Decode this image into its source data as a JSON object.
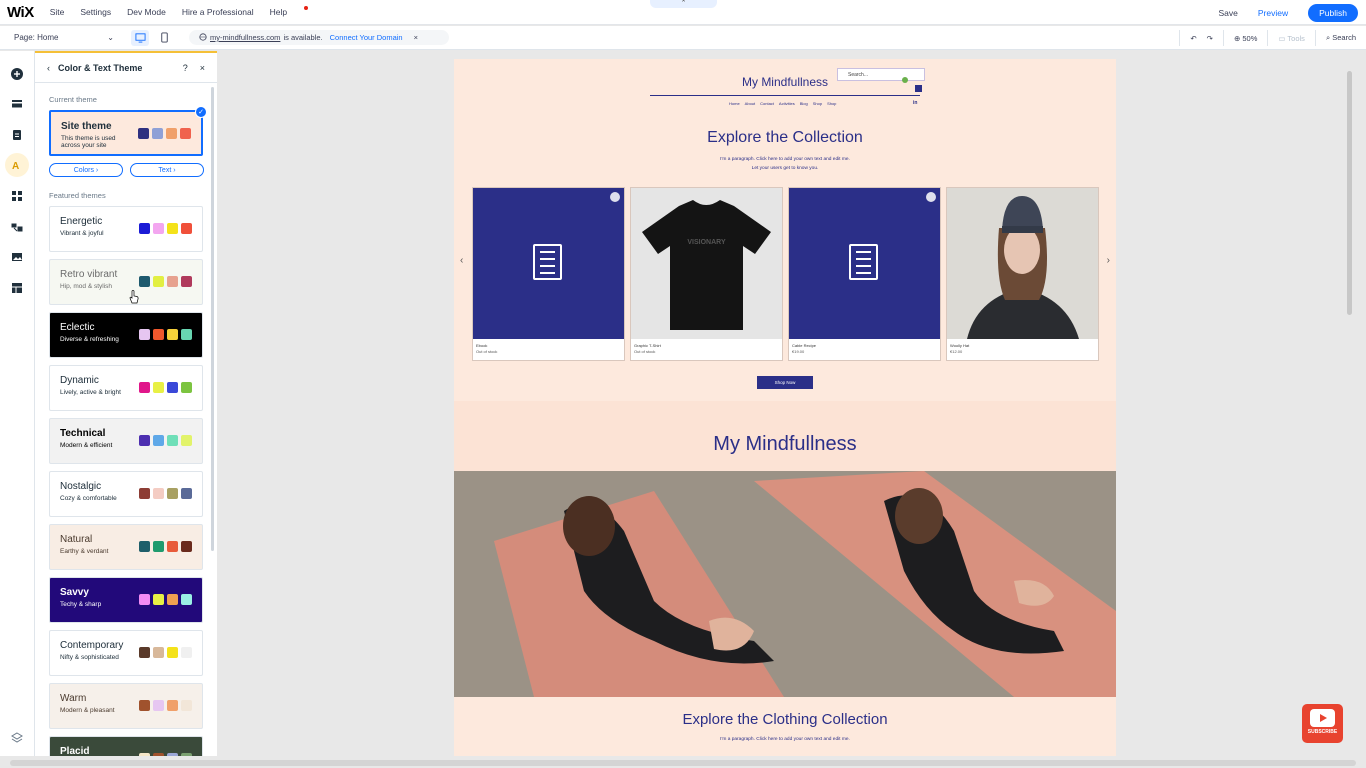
{
  "topbar": {
    "logo": "WiX",
    "menu": [
      "Site",
      "Settings",
      "Dev Mode",
      "Hire a Professional",
      "Help"
    ],
    "save": "Save",
    "preview": "Preview",
    "publish": "Publish"
  },
  "secondbar": {
    "page_label": "Page: Home",
    "page_chevron": "⌄",
    "domain": "my-mindfullness.com",
    "available": "is available.",
    "connect": "Connect Your Domain",
    "close": "×",
    "zoom": "50%",
    "tools": "Tools",
    "search": "Search"
  },
  "panel": {
    "back": "‹",
    "title": "Color & Text Theme",
    "help": "?",
    "close": "×",
    "current_label": "Current theme",
    "current": {
      "name": "Site theme",
      "desc": "This theme is used across your site",
      "swatches": [
        "#2f3180",
        "#8fa0d6",
        "#f0a06a",
        "#f0624d"
      ],
      "bg": "#fde9dd"
    },
    "colors_btn": "Colors",
    "text_btn": "Text",
    "chev": "›",
    "featured_label": "Featured themes",
    "themes": [
      {
        "name": "Energetic",
        "desc": "Vibrant & joyful",
        "bg": "#ffffff",
        "fg": "#20303c",
        "bold": false,
        "swatches": [
          "#1b1bd6",
          "#f3a6f0",
          "#f4e21a",
          "#f0503a"
        ]
      },
      {
        "name": "Retro vibrant",
        "desc": "Hip, mod & stylish",
        "bg": "#f6f8f2",
        "fg": "#6b6b6b",
        "bold": false,
        "swatches": [
          "#1e5a6e",
          "#e2ef42",
          "#e7a28f",
          "#b03a5c"
        ]
      },
      {
        "name": "Eclectic",
        "desc": "Diverse & refreshing",
        "bg": "#000000",
        "fg": "#ffffff",
        "bold": false,
        "swatches": [
          "#e6c6f1",
          "#f0582d",
          "#f6d13a",
          "#68d6b1"
        ]
      },
      {
        "name": "Dynamic",
        "desc": "Lively, active & bright",
        "bg": "#ffffff",
        "fg": "#20303c",
        "bold": false,
        "swatches": [
          "#e0168a",
          "#e8f045",
          "#3a48d8",
          "#7cc440"
        ]
      },
      {
        "name": "Technical",
        "desc": "Modern & efficient",
        "bg": "#f2f2f2",
        "fg": "#000000",
        "bold": true,
        "swatches": [
          "#4d2fb0",
          "#5fa8e8",
          "#6fdfb8",
          "#e2f36a"
        ]
      },
      {
        "name": "Nostalgic",
        "desc": "Cozy & comfortable",
        "bg": "#ffffff",
        "fg": "#20303c",
        "bold": false,
        "swatches": [
          "#8d3d35",
          "#f4ccc3",
          "#a8a062",
          "#5a6a98"
        ]
      },
      {
        "name": "Natural",
        "desc": "Earthy & verdant",
        "bg": "#f8ede4",
        "fg": "#4a3a2e",
        "bold": false,
        "swatches": [
          "#1e5e6a",
          "#1f9b6e",
          "#e85b3a",
          "#6a2a1c"
        ]
      },
      {
        "name": "Savvy",
        "desc": "Techy & sharp",
        "bg": "#22097a",
        "fg": "#ffffff",
        "bold": true,
        "swatches": [
          "#f28bf4",
          "#e8f045",
          "#f0a050",
          "#9af0e4"
        ]
      },
      {
        "name": "Contemporary",
        "desc": "Nifty & sophisticated",
        "bg": "#ffffff",
        "fg": "#20303c",
        "bold": false,
        "swatches": [
          "#5a3a2a",
          "#d8b89a",
          "#f4e21a",
          "#f0f0f0"
        ]
      },
      {
        "name": "Warm",
        "desc": "Modern & pleasant",
        "bg": "#f6f0ea",
        "fg": "#4a3a2e",
        "bold": false,
        "swatches": [
          "#a0522d",
          "#e6c6f1",
          "#f0a06a",
          "#f2e6d8"
        ]
      },
      {
        "name": "Placid",
        "desc": "",
        "bg": "#3a4a3a",
        "fg": "#ffffff",
        "bold": true,
        "swatches": [
          "#f4e6c8",
          "#a0522d",
          "#9aa6d6",
          "#7aa070"
        ]
      }
    ]
  },
  "site": {
    "title": "My Mindfullness",
    "search_placeholder": "Search...",
    "nav": [
      "Home",
      "About",
      "Contact",
      "Activities",
      "Blog",
      "Shop",
      "Shop"
    ],
    "linkedin": "in",
    "heading": "Explore the Collection",
    "paragraph_1": "I'm a paragraph. Click here to add your own text and edit me.",
    "paragraph_2": "Let your users get to know you.",
    "products": [
      {
        "name": "Ebook",
        "price": "Out of stock",
        "kind": "doc"
      },
      {
        "name": "Graphic T-Shirt",
        "price": "Out of stock",
        "kind": "shirt",
        "shirt_text": "VISIONARY"
      },
      {
        "name": "Cable Recipe",
        "price": "€19.00",
        "kind": "doc"
      },
      {
        "name": "Woolly Hat",
        "price": "€12.00",
        "kind": "photo"
      }
    ],
    "arrow_prev": "‹",
    "arrow_next": "›",
    "shop_button": "Shop Now",
    "band_title": "My Mindfullness",
    "collection_title": "Explore the Clothing Collection",
    "collection_p": "I'm a paragraph. Click here to add your own text and edit me."
  },
  "subscribe": "SUBSCRIBE",
  "colors": {
    "accent": "#116dff",
    "site_primary": "#2b2f88",
    "site_bg": "#fde9dd"
  }
}
